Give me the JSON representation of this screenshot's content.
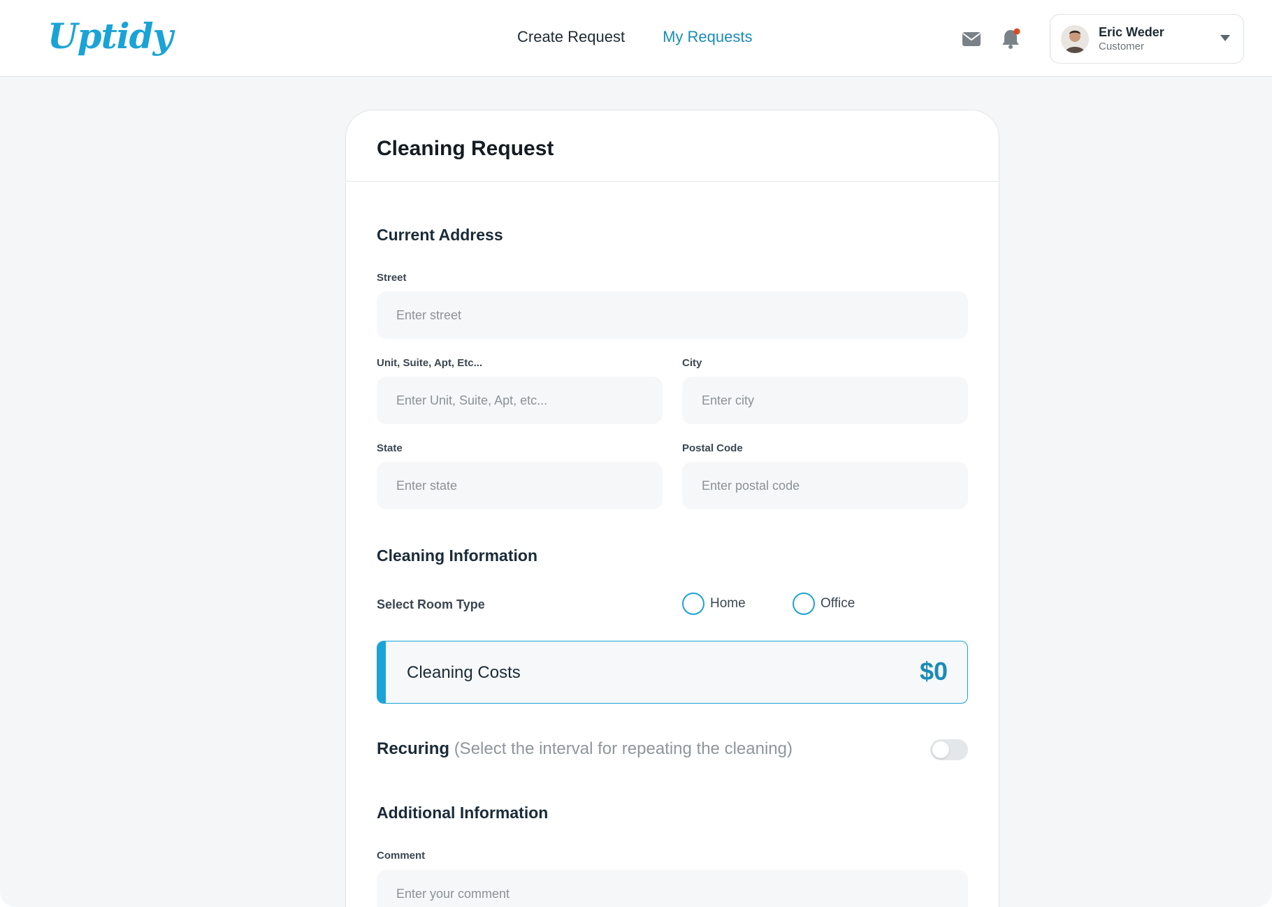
{
  "brand": {
    "logo_text": "Uptidy"
  },
  "nav": {
    "items": [
      {
        "label": "Create Request"
      },
      {
        "label": "My Requests"
      }
    ]
  },
  "header": {
    "icons": [
      "mail-icon",
      "bell-icon"
    ]
  },
  "user": {
    "name": "Eric Weder",
    "role": "Customer"
  },
  "form": {
    "title": "Cleaning Request",
    "address_section": {
      "title": "Current Address",
      "street": {
        "label": "Street",
        "placeholder": "Enter street",
        "value": ""
      },
      "unit": {
        "label": "Unit, Suite, Apt, Etc...",
        "placeholder": "Enter Unit, Suite, Apt, etc...",
        "value": ""
      },
      "city": {
        "label": "City",
        "placeholder": "Enter city",
        "value": ""
      },
      "state": {
        "label": "State",
        "placeholder": "Enter state",
        "value": ""
      },
      "postal_code": {
        "label": "Postal Code",
        "placeholder": "Enter postal code",
        "value": ""
      }
    },
    "cleaning_section": {
      "title": "Cleaning Information",
      "room_type_label": "Select Room Type",
      "room_type_options": [
        "Home",
        "Office"
      ],
      "costs_label": "Cleaning Costs",
      "costs_value": "$0"
    },
    "recurring": {
      "title": "Recuring",
      "hint": "(Select the interval for repeating the cleaning)",
      "enabled": false
    },
    "additional_section": {
      "title": "Additional Information",
      "comment": {
        "label": "Comment",
        "placeholder": "Enter your comment",
        "value": ""
      }
    }
  },
  "colors": {
    "accent": "#1aa3d6",
    "accent_dark": "#1b8bb8",
    "notification_dot": "#e2481e",
    "background": "#f5f6f7"
  }
}
